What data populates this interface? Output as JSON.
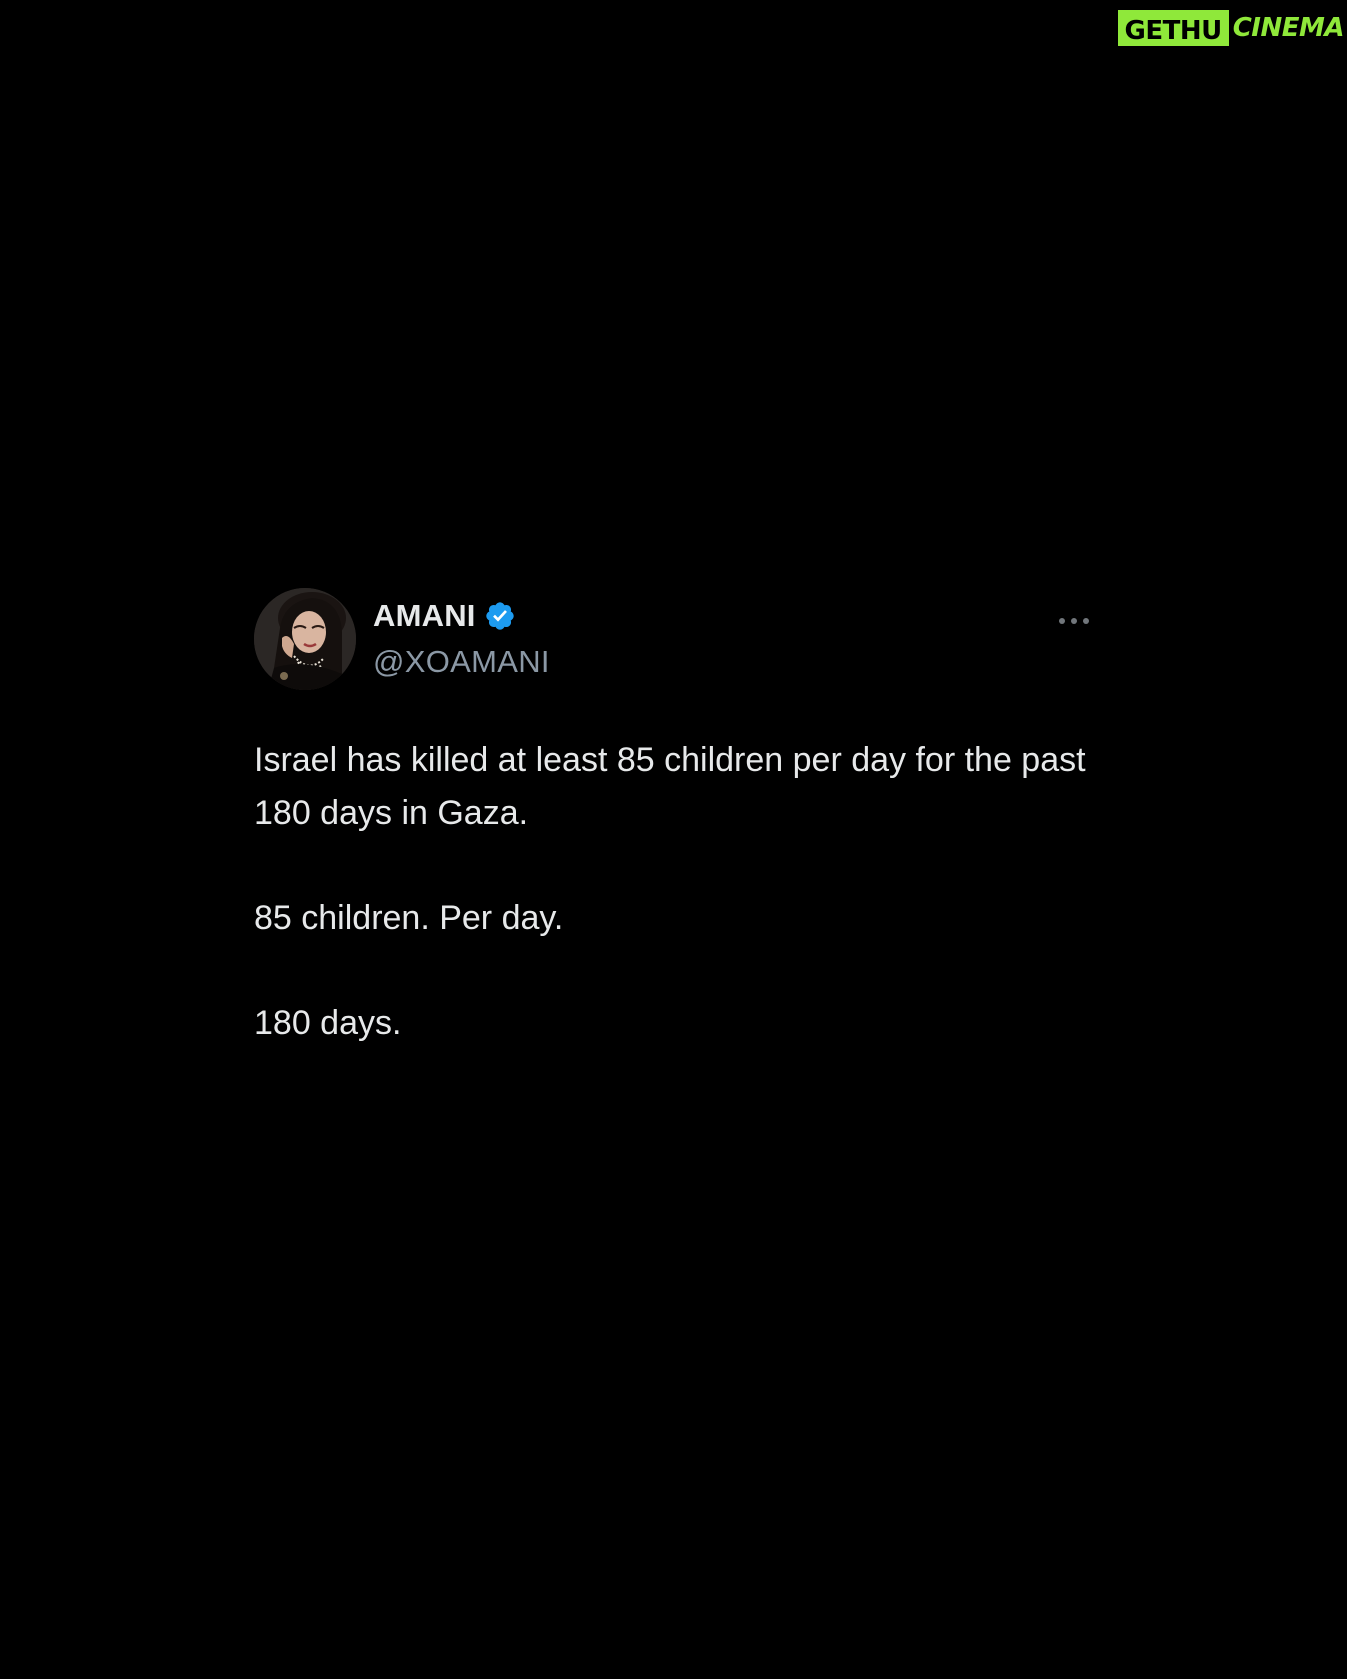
{
  "watermark": {
    "left": "GETHU",
    "middle": "",
    "right": "CINEMA",
    "color": "#8fe83a"
  },
  "tweet": {
    "display_name": "AMANI",
    "handle": "@XOAMANI",
    "verified_icon": "verified-badge-icon",
    "verified_color": "#1d9bf0",
    "more_icon": "more-options-icon",
    "avatar_icon": "profile-avatar",
    "paragraphs": [
      "Israel has killed at least 85 children per day for the past 180 days in Gaza.",
      "85 children. Per day.",
      "180 days."
    ]
  }
}
